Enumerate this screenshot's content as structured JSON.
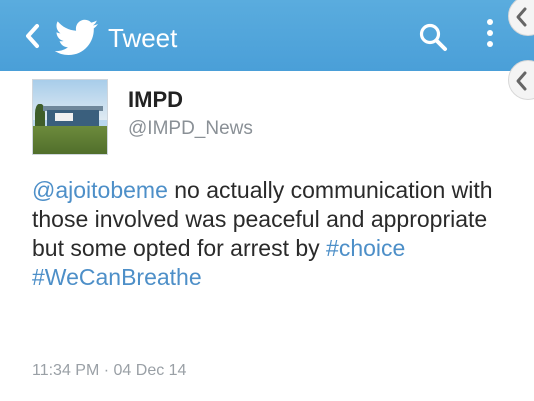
{
  "topbar": {
    "title": "Tweet",
    "icons": [
      "back-chevron-icon",
      "twitter-bird-icon",
      "search-icon",
      "more-options-icon"
    ],
    "color": "#4fa3dc"
  },
  "tweet": {
    "display_name": "IMPD",
    "handle": "@IMPD_News",
    "avatar_sign_text": "IMPD",
    "body": {
      "mention": "@ajoitobeme",
      "text": " no actually communication with those involved was peaceful and appropriate but some opted for arrest by ",
      "hashtag_1": "#choice",
      "separator": " ",
      "hashtag_2": "#WeCanBreathe"
    },
    "timestamp": "11:34 PM · 04 Dec 14"
  },
  "colors": {
    "link": "#4d8fc8",
    "meta": "#9aa0a6",
    "text": "#2a2a2a"
  }
}
